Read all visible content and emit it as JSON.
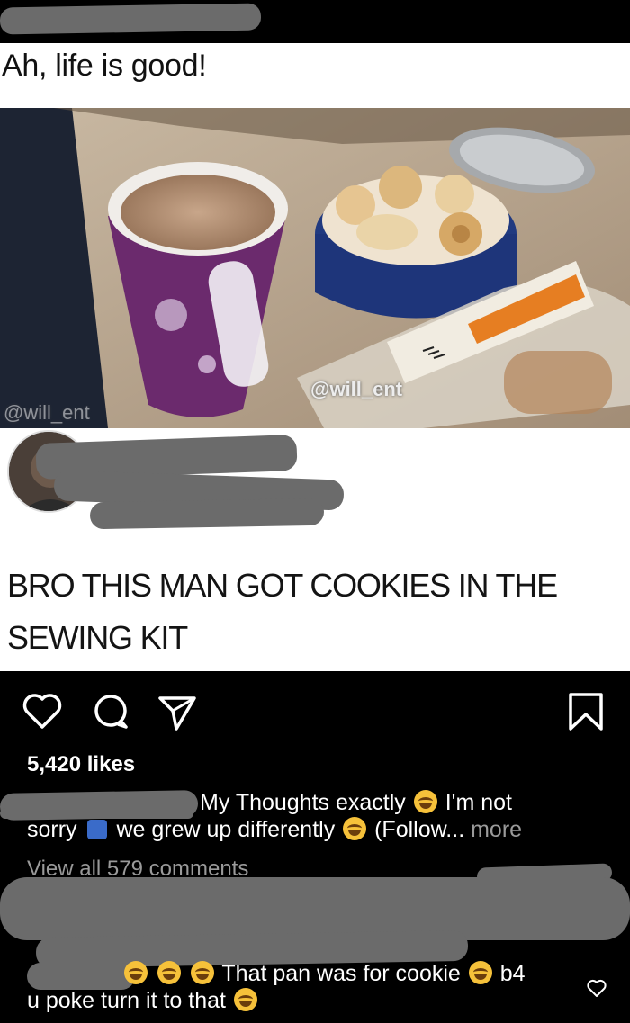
{
  "post": {
    "caption": "Ah, life is good!",
    "photo_watermark_center": "@will_ent",
    "photo_watermark_left": "@will_ent",
    "reply_text": "BRO THIS MAN GOT COOKIES IN THE SEWING KIT"
  },
  "icons": {
    "like": "heart-icon",
    "comment": "comment-icon",
    "share": "send-icon",
    "save": "bookmark-icon",
    "comment_like": "heart-icon"
  },
  "likes": {
    "count_text": "5,420 likes"
  },
  "caption_block": {
    "line1_text_a": "My Thoughts exactly",
    "line1_text_b": "I'm not",
    "line2_text_a": "sorry",
    "line2_text_b": "we grew up differently",
    "line2_text_c": "(Follow...",
    "line2_more": "more"
  },
  "comments": {
    "view_all": "View all 579 comments",
    "comment2_line1_a": "That pan was for cookie",
    "comment2_line1_b": "b4",
    "comment2_line2": "u poke turn it to that"
  },
  "colors": {
    "background": "#000000",
    "card": "#ffffff",
    "redaction": "#6b6b6b",
    "muted_text": "#9a9a9a"
  }
}
